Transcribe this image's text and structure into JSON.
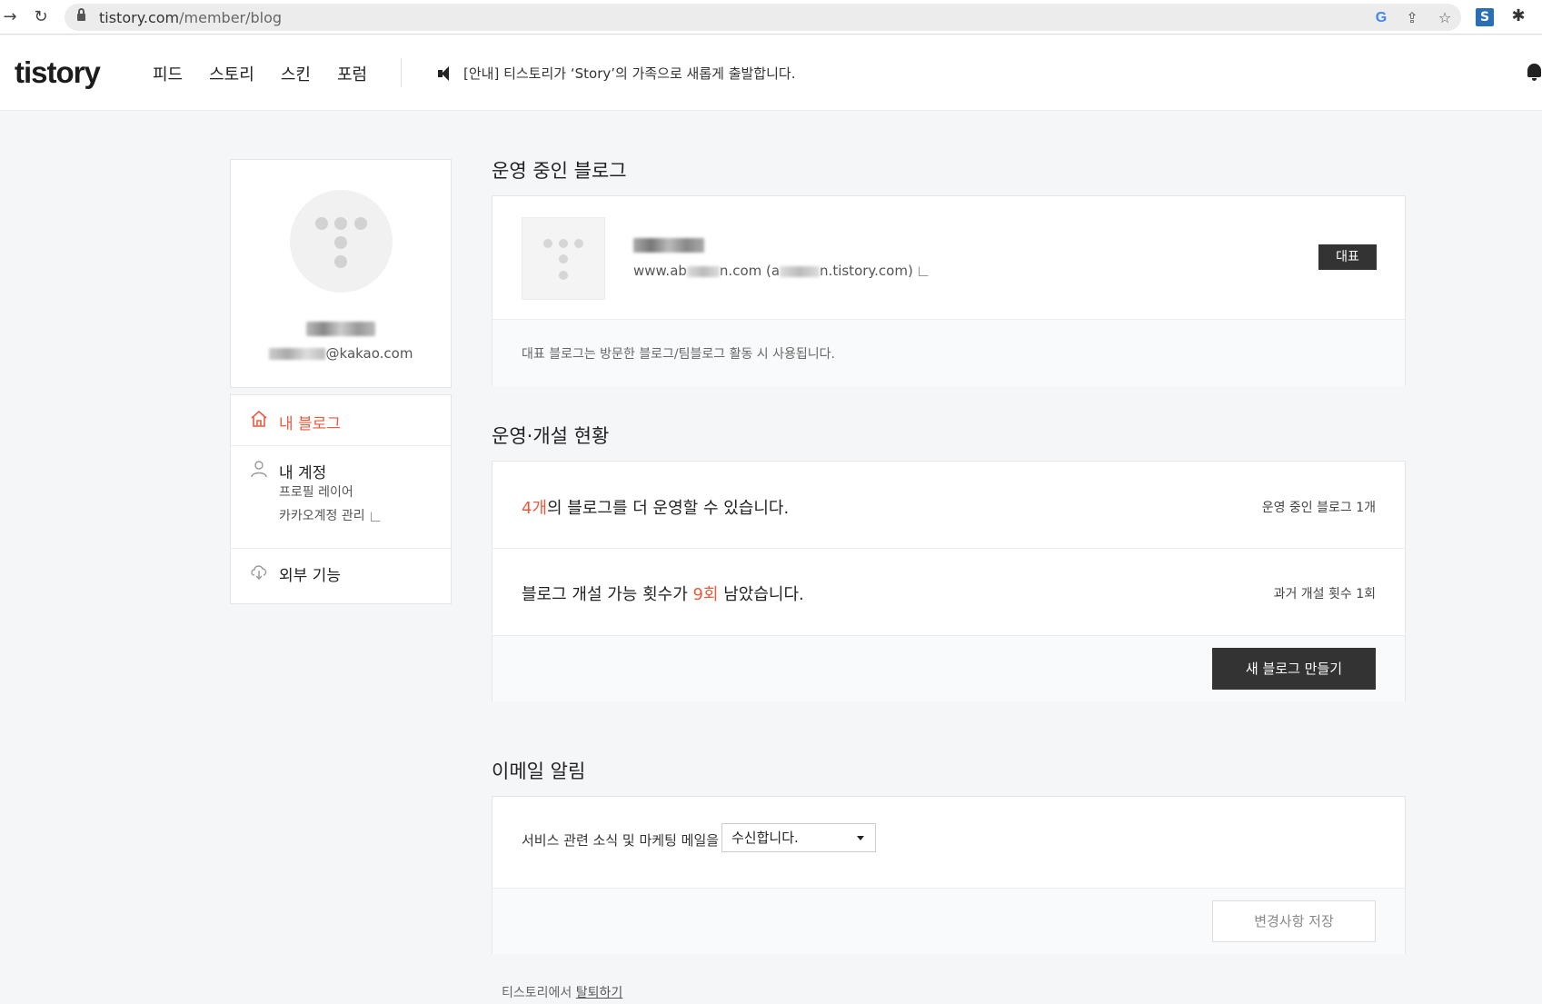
{
  "browser": {
    "url_host": "tistory.com",
    "url_path": "/member/blog"
  },
  "header": {
    "logo": "tistory",
    "nav": [
      "피드",
      "스토리",
      "스킨",
      "포럼"
    ],
    "notice": "[안내] 티스토리가 ‘Story’의 가족으로 새롭게 출발합니다."
  },
  "profile": {
    "email_suffix": "@kakao.com"
  },
  "sidebar": {
    "my_blog": "내 블로그",
    "my_account": "내 계정",
    "profile_layer": "프로필 레이어",
    "kakao_account": "카카오계정 관리",
    "external": "외부 기능"
  },
  "blogs": {
    "title": "운영 중인 블로그",
    "url_prefix": "www.ab",
    "url_mid": "n.com (a",
    "url_suffix": "n.tistory.com)",
    "badge": "대표",
    "note": "대표 블로그는 방문한 블로그/팀블로그 활동 시 사용됩니다."
  },
  "status": {
    "title": "운영·개설 현황",
    "row1_count": "4개",
    "row1_text": "의 블로그를 더 운영할 수 있습니다.",
    "row1_side": "운영 중인 블로그 1개",
    "row2_prefix": "블로그 개설 가능 횟수가 ",
    "row2_count": "9회",
    "row2_suffix": " 남았습니다.",
    "row2_side": "과거 개설 횟수 1회",
    "create_button": "새 블로그 만들기"
  },
  "email": {
    "title": "이메일 알림",
    "label": "서비스 관련 소식 및 마케팅 메일을",
    "select_value": "수신합니다.",
    "save_button": "변경사항 저장"
  },
  "footer": {
    "leave_prefix": "티스토리에서 ",
    "leave_link": "탈퇴하기"
  },
  "colors": {
    "accent": "#ea5a3d",
    "dark_button": "#333333"
  }
}
